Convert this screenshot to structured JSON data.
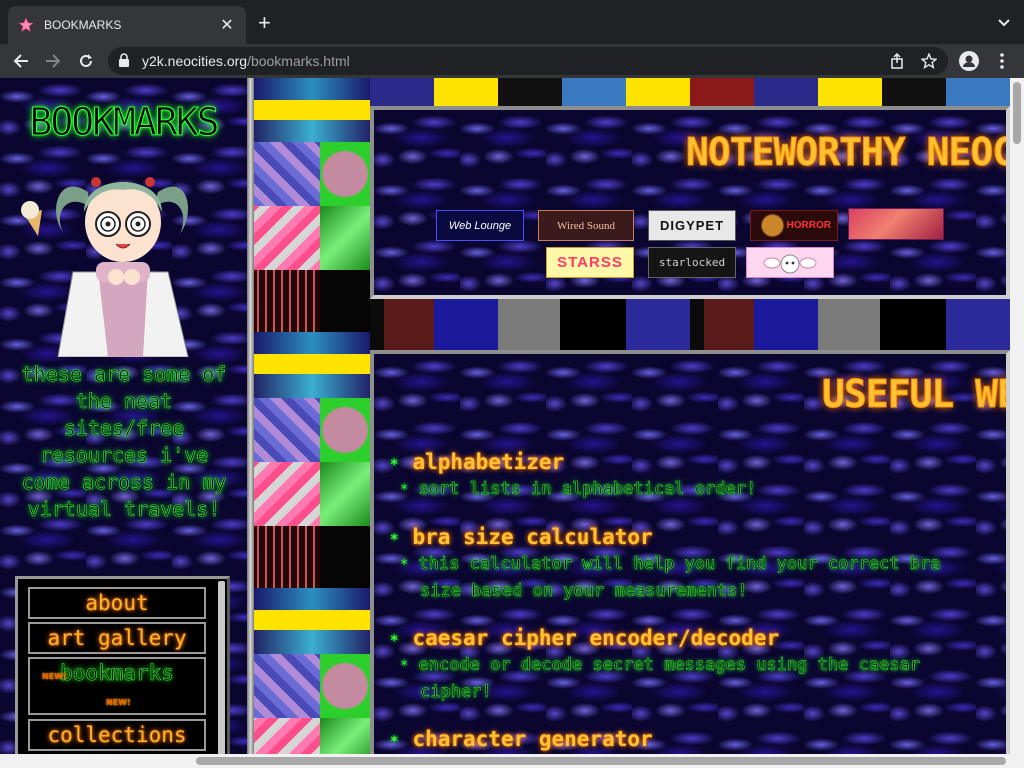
{
  "browser": {
    "tab_title": "BOOKMARKS",
    "url_host": "y2k.neocities.org",
    "url_path": "/bookmarks.html",
    "new_tab_label": "+",
    "close_label": "✕"
  },
  "sidebar": {
    "title": "BOOKMARKS",
    "description": "these are some of the neat sites/free resources i've come across in my virtual travels!",
    "menu": [
      {
        "label": "about"
      },
      {
        "label": "art gallery"
      },
      {
        "label": "bookmarks",
        "badge": "NEW!"
      },
      {
        "label": "collections"
      }
    ]
  },
  "panels": {
    "noteworthy": {
      "heading": "NOTEWORTHY NEOCITIES",
      "buttons": [
        {
          "label": "Web Lounge"
        },
        {
          "label": "Wired Sound"
        },
        {
          "label": "DIGYPET"
        },
        {
          "label": "HORROR"
        },
        {
          "label": ""
        },
        {
          "label": "STARSS"
        },
        {
          "label": "starlocked"
        },
        {
          "label": ""
        }
      ]
    },
    "useful": {
      "heading": "USEFUL WEBSITES",
      "items": [
        {
          "name": "alphabetizer",
          "desc": "sort lists in alphabetical order!"
        },
        {
          "name": "bra size calculator",
          "desc": "this calculator will help you find your correct bra size based on your measurements!"
        },
        {
          "name": "caesar cipher encoder/decoder",
          "desc": "encode or decode secret messages using the caesar cipher!"
        },
        {
          "name": "character generator",
          "desc": ""
        }
      ]
    }
  },
  "colors": {
    "neon_green": "#33ff33",
    "neon_orange": "#ffc233",
    "swirl_purple": "#5a46e6"
  }
}
